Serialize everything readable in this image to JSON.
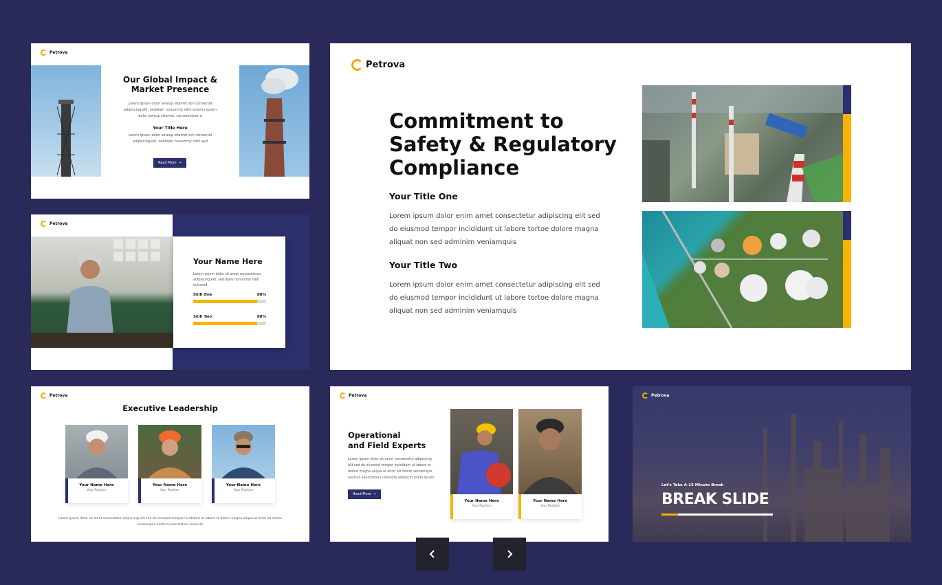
{
  "brand": {
    "name": "Petrova",
    "accent": "#f6b400",
    "navy": "#2b2f6b",
    "background": "#29295a"
  },
  "slide1": {
    "title_line1": "Our Global Impact &",
    "title_line2": "Market Presence",
    "para1": "Lorem ipsum dolor seteup sitamet son consectet adipiscing elit, seddiam nonummy nibh euismo ipsum dolor seteup sitamet, consectetuer a",
    "subtitle": "Your Title Here",
    "para2": "Lorem ipsum dolor seteup sitamet sch consectet adipiscing elit, seddiam nonummy nibh eyd",
    "button": "Read More"
  },
  "slide2": {
    "name": "Your Name Here",
    "para": "Lorem ipsum dolor sit amet consectetuer adipiscing elit, sed diam nonummy nibh euismod",
    "skills": [
      {
        "label": "Skill One",
        "value": "88%",
        "fraction": 0.88
      },
      {
        "label": "Skill Two",
        "value": "88%",
        "fraction": 0.88
      }
    ]
  },
  "main": {
    "title_line1": "Commitment to",
    "title_line2": "Safety & Regulatory",
    "title_line3": "Compliance",
    "section1_title": "Your Title One",
    "section1_line1": "Lorem ipsum dolor enim amet consectetur adipiscing elit sed",
    "section1_line2": "do eiusmod tempor incididunt ut labore tortoe dolore magna",
    "section1_line3": "aliquat non sed adminim veniamquis",
    "section2_title": "Your Title Two",
    "section2_line1": "Lorem ipsum dolor enim amet consectetur adipiscing elit sed",
    "section2_line2": "do eiusmod tempor incididunt ut labore tortoe dolore magna",
    "section2_line3": "aliquat non sed adminim veniamquis"
  },
  "slide3": {
    "title": "Executive Leadership",
    "people": [
      {
        "name": "Your Name Here",
        "position": "Your Position"
      },
      {
        "name": "Your Name Here",
        "position": "Your Position"
      },
      {
        "name": "Your Name Here",
        "position": "Your Position"
      }
    ],
    "footer_line1": "Lorem ipsum dolor sit amet consectetur adipis  ong elit sed do eiusmod tempor incididunt ut labore et dolore magna aliqua ut enim ad minim",
    "footer_line2": "veniamquis nostrud exercitation consecte"
  },
  "slide4": {
    "title_line1": "Operational",
    "title_line2": "and Field Experts",
    "para": "Lorem ipsum dolor sit amet consectetur adipiscing elit sed do eiusmod tempor incididunt ut labore et dolore magna aliqua ut enim ad minim veniamquis nostrud exercitation consecte adipiscin lorem ipsum",
    "button": "Read More",
    "people": [
      {
        "name": "Your Name Here",
        "position": "Your Position"
      },
      {
        "name": "Your Name Here",
        "position": "Your Position"
      }
    ]
  },
  "slide5": {
    "kicker": "Let's Take A-15 Minute Break",
    "title": "BREAK SLIDE"
  },
  "icons": {
    "prev": "chevron-left-icon",
    "next": "chevron-right-icon",
    "arrow": "arrow-right-icon"
  }
}
